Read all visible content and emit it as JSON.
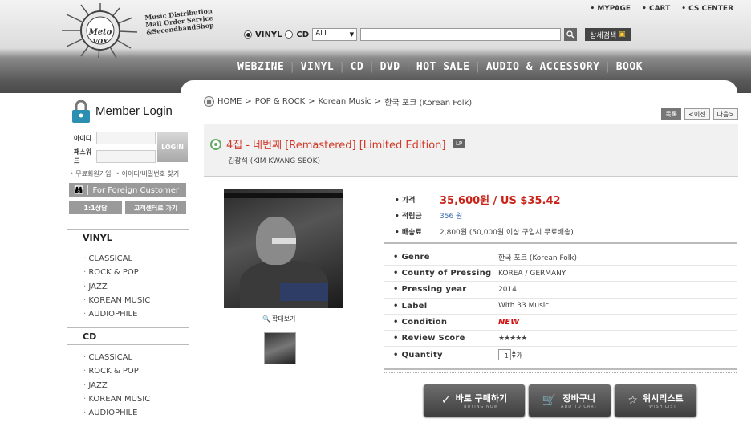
{
  "header": {
    "logo_text": "Meto\nvox",
    "tagline": [
      "Music Distribution",
      "Mail Order Service",
      "&SecondhandShop"
    ],
    "top_links": [
      "MYPAGE",
      "CART",
      "CS CENTER"
    ],
    "search": {
      "radio_vinyl": "VINYL",
      "radio_cd": "CD",
      "select_value": "ALL",
      "advanced_label": "상세검색"
    },
    "nav": [
      "WEBZINE",
      "VINYL",
      "CD",
      "DVD",
      "HOT SALE",
      "AUDIO & ACCESSORY",
      "BOOK"
    ]
  },
  "sidebar": {
    "login_title": "Member Login",
    "id_label": "아이디",
    "pw_label": "패스워드",
    "login_button": "LOGIN",
    "signup_link": "무료회원가입",
    "find_link": "아이디/비밀번호 찾기",
    "foreign_button": "For Foreign Customer",
    "consult_button": "1:1상담",
    "cs_button": "고객센터로 가기",
    "vinyl_heading": "VINYL",
    "vinyl_items": [
      "CLASSICAL",
      "ROCK & POP",
      "JAZZ",
      "KOREAN MUSIC",
      "AUDIOPHILE"
    ],
    "cd_heading": "CD",
    "cd_items": [
      "CLASSICAL",
      "ROCK & POP",
      "JAZZ",
      "KOREAN MUSIC",
      "AUDIOPHILE"
    ]
  },
  "breadcrumb": [
    "HOME",
    "POP & ROCK",
    "Korean Music",
    "한국 포크 (Korean Folk)"
  ],
  "pager": {
    "list": "목록",
    "prev": "<이전",
    "next": "다음>"
  },
  "product": {
    "title": "4집 - 네번째 [Remastered] [Limited Edition]",
    "format_badge": "LP",
    "artist": "김광석 (KIM KWANG SEOK)",
    "zoom_label": "확대보기",
    "price_label": "가격",
    "price": "35,600원 / US $35.42",
    "points_label": "적립금",
    "points": "356 원",
    "shipping_label": "배송료",
    "shipping": "2,800원 (50,000원 이상 구입시 무료배송)",
    "specs": [
      {
        "label": "Genre",
        "value": "한국 포크 (Korean Folk)"
      },
      {
        "label": "County of Pressing",
        "value": "KOREA / GERMANY"
      },
      {
        "label": "Pressing year",
        "value": "2014"
      },
      {
        "label": "Label",
        "value": "With 33 Music"
      },
      {
        "label": "Condition",
        "value": "NEW"
      },
      {
        "label": "Review Score",
        "value": "★★★★★"
      },
      {
        "label": "Quantity",
        "value": "1"
      }
    ],
    "qty_unit": "개",
    "review_score": 5,
    "colors": {
      "price": "#c8241a",
      "title": "#d23a2a",
      "condition": "#d01010",
      "stars": "#f08a1a"
    }
  },
  "actions": {
    "buy_now": "바로 구매하기",
    "buy_now_sub": "BUYING NOW",
    "add_cart": "장바구니",
    "add_cart_sub": "ADD TO CART",
    "wishlist": "위시리스트",
    "wishlist_sub": "WISH LIST"
  }
}
